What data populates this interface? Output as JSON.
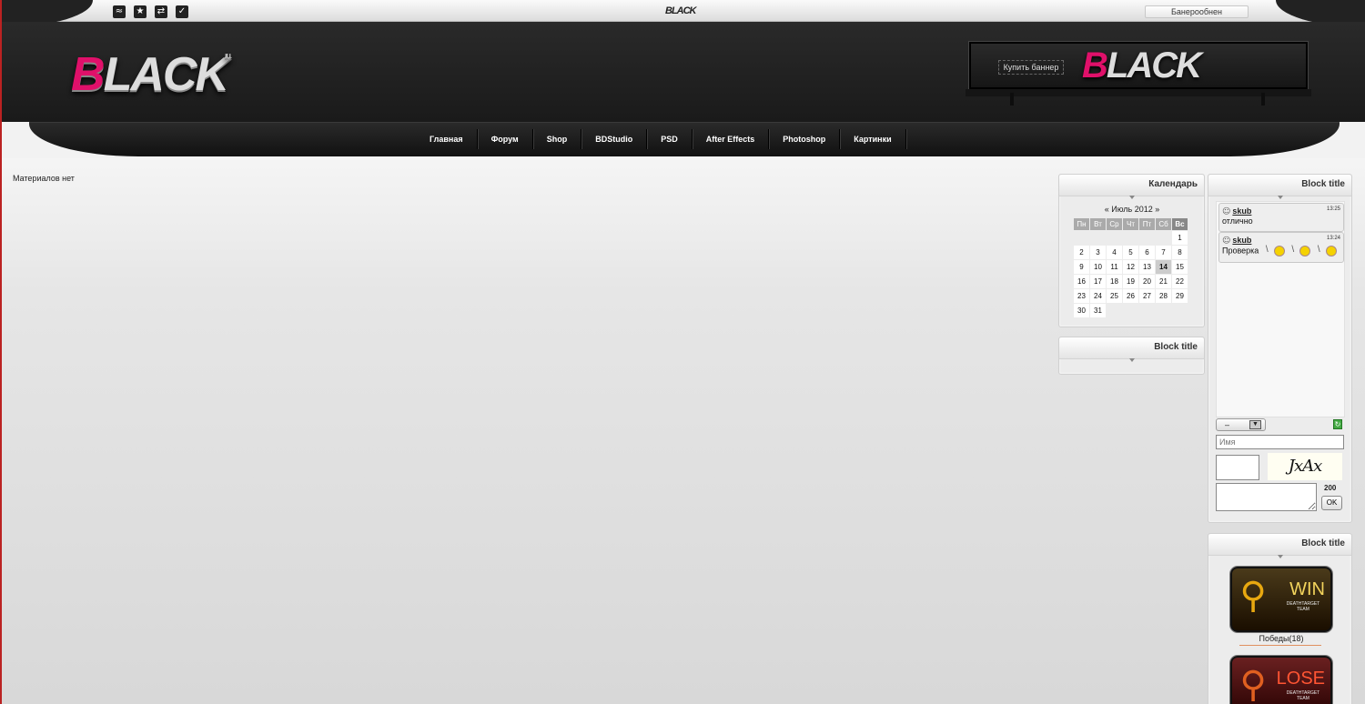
{
  "topbar": {
    "icons": [
      "rss-icon",
      "star-icon",
      "share-icon",
      "check-icon"
    ],
    "mini_logo": "BLACK",
    "banner_button": "Банерообнен"
  },
  "header": {
    "logo": "BLACK",
    "logo_suffix": ".ru",
    "banner": {
      "buy_button": "Купить баннер",
      "logo": "BLACK"
    }
  },
  "nav": {
    "items": [
      "Главная",
      "Форум",
      "Shop",
      "BDStudio",
      "PSD",
      "After Effects",
      "Photoshop",
      "Картинки"
    ]
  },
  "main": {
    "empty_text": "Материалов нет"
  },
  "calendar": {
    "title": "Календарь",
    "prev": "«",
    "next": "»",
    "month": "Июль 2012",
    "weekdays": [
      "Пн",
      "Вт",
      "Ср",
      "Чт",
      "Пт",
      "Сб",
      "Вс"
    ],
    "weeks": [
      [
        "",
        "",
        "",
        "",
        "",
        "",
        "1"
      ],
      [
        "2",
        "3",
        "4",
        "5",
        "6",
        "7",
        "8"
      ],
      [
        "9",
        "10",
        "11",
        "12",
        "13",
        "14",
        "15"
      ],
      [
        "16",
        "17",
        "18",
        "19",
        "20",
        "21",
        "22"
      ],
      [
        "23",
        "24",
        "25",
        "26",
        "27",
        "28",
        "29"
      ],
      [
        "30",
        "31",
        "",
        "",
        "",
        "",
        ""
      ]
    ],
    "today": "14"
  },
  "block2": {
    "title": "Block title"
  },
  "chat": {
    "title": "Block title",
    "messages": [
      {
        "user": "skub",
        "time": "13:25",
        "text": "отлично"
      },
      {
        "user": "skub",
        "time": "13:24",
        "text": "Проверка"
      }
    ],
    "select_value": "–",
    "name_placeholder": "Имя",
    "captcha": "JxAx",
    "counter": "200",
    "ok_label": "OK"
  },
  "awards": {
    "title": "Block title",
    "win": {
      "word": "WIN",
      "sub": "DEATHTARGET TEAM",
      "label": "Победы(18)"
    },
    "lose": {
      "word": "LOSE",
      "sub": "DEATHTARGET TEAM"
    }
  },
  "colors": {
    "accent_pink": "#e0106a",
    "header_dark": "#1a1a1a"
  }
}
